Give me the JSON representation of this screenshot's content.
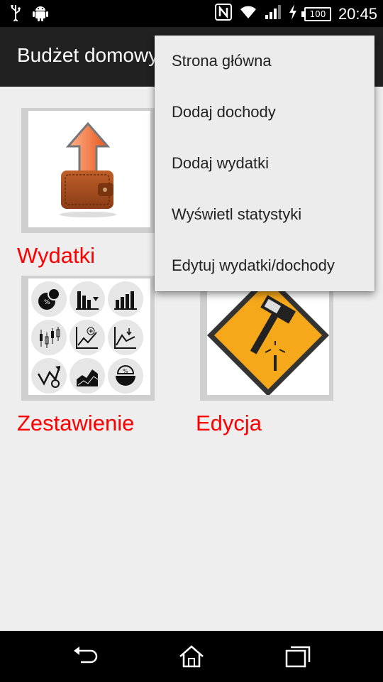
{
  "status_bar": {
    "time": "20:45",
    "battery": "100",
    "icons": [
      "usb-icon",
      "android-icon",
      "nfc-icon",
      "wifi-icon",
      "signal-icon",
      "charging-icon"
    ]
  },
  "action_bar": {
    "title": "Budżet domowy"
  },
  "tiles": [
    {
      "label": "Wydatki",
      "icon": "wallet-arrow-icon"
    },
    {
      "label": "Zestawienie",
      "icon": "statistics-icons-grid"
    },
    {
      "label": "Edycja",
      "icon": "hammer-warning-sign-icon"
    }
  ],
  "popup_menu": {
    "items": [
      {
        "label": "Strona główna"
      },
      {
        "label": "Dodaj dochody"
      },
      {
        "label": "Dodaj wydatki"
      },
      {
        "label": "Wyświetl statystyki"
      },
      {
        "label": "Edytuj wydatki/dochody"
      }
    ]
  },
  "nav_bar": {
    "buttons": [
      "back-icon",
      "home-icon",
      "recents-icon"
    ]
  },
  "colors": {
    "status_bar": "#000000",
    "action_bar": "#212121",
    "background": "#eeeeee",
    "tile_label": "#ff0000",
    "menu_bg": "#ececec"
  }
}
